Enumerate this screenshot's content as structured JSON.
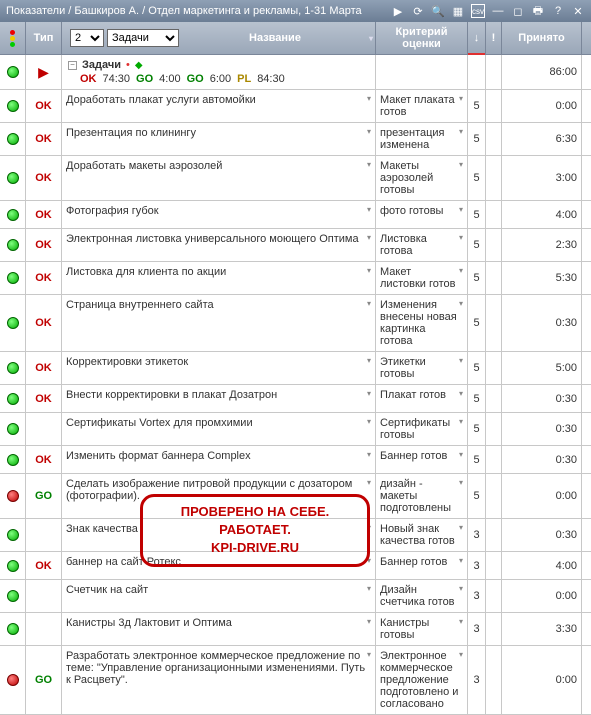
{
  "titlebar": {
    "title": "Показатели / Башкиров А. / Отдел маркетинга и рекламы, 1-31 Марта"
  },
  "header": {
    "type": "Тип",
    "level": "2",
    "category": "Задачи",
    "name": "Название",
    "criteria": "Критерий оценки",
    "arrow": "↓",
    "excl": "!",
    "accepted": "Принято"
  },
  "summary": {
    "label": "Задачи",
    "segments": [
      {
        "tag": "OK",
        "cls": "l-ok",
        "val": "74:30"
      },
      {
        "tag": "GO",
        "cls": "l-go",
        "val": "4:00"
      },
      {
        "tag": "GO",
        "cls": "l-go",
        "val": "6:00"
      },
      {
        "tag": "PL",
        "cls": "l-pl",
        "val": "84:30"
      }
    ],
    "accepted": "86:00"
  },
  "rows": [
    {
      "light": "green",
      "type": "OK",
      "name": "Доработать плакат услуги автомойки",
      "crit": "Макет плаката готов",
      "score": "5",
      "accepted": "0:00"
    },
    {
      "light": "green",
      "type": "OK",
      "name": "Презентация по клинингу",
      "crit": "презентация изменена",
      "score": "5",
      "accepted": "6:30"
    },
    {
      "light": "green",
      "type": "OK",
      "name": "Доработать макеты аэрозолей",
      "crit": "Макеты аэрозолей готовы",
      "score": "5",
      "accepted": "3:00"
    },
    {
      "light": "green",
      "type": "OK",
      "name": "Фотография губок",
      "crit": "фото готовы",
      "score": "5",
      "accepted": "4:00"
    },
    {
      "light": "green",
      "type": "OK",
      "name": "Электронная листовка универсального моющего Оптима",
      "crit": "Листовка готова",
      "score": "5",
      "accepted": "2:30"
    },
    {
      "light": "green",
      "type": "OK",
      "name": "Листовка для клиента по акции",
      "crit": "Макет листовки готов",
      "score": "5",
      "accepted": "5:30"
    },
    {
      "light": "green",
      "type": "OK",
      "name": "Страница внутреннего сайта",
      "crit": "Изменения внесены новая картинка готова",
      "score": "5",
      "accepted": "0:30"
    },
    {
      "light": "green",
      "type": "OK",
      "name": "Корректировки этикеток",
      "crit": "Этикетки готовы",
      "score": "5",
      "accepted": "5:00"
    },
    {
      "light": "green",
      "type": "OK",
      "name": "Внести корректировки в плакат Дозатрон",
      "crit": "Плакат готов",
      "score": "5",
      "accepted": "0:30"
    },
    {
      "light": "green",
      "type": "",
      "name": "Сертификаты Vortex для промхимии",
      "crit": "Сертификаты готовы",
      "score": "5",
      "accepted": "0:30"
    },
    {
      "light": "green",
      "type": "OK",
      "name": "Изменить формат баннера Complex",
      "crit": "Баннер готов",
      "score": "5",
      "accepted": "0:30"
    },
    {
      "light": "red",
      "type": "GO",
      "name": "Сделать изображение питровой продукции с дозатором (фотографии).",
      "crit": "дизайн - макеты подготовлены",
      "score": "5",
      "accepted": "0:00"
    },
    {
      "light": "green",
      "type": "",
      "name": "Знак качества",
      "crit": "Новый знак качества готов",
      "score": "3",
      "accepted": "0:30"
    },
    {
      "light": "green",
      "type": "OK",
      "name": "баннер на сайт Ротекс",
      "crit": "Баннер готов",
      "score": "3",
      "accepted": "4:00"
    },
    {
      "light": "green",
      "type": "",
      "name": "Счетчик на сайт",
      "crit": "Дизайн счетчика готов",
      "score": "3",
      "accepted": "0:00"
    },
    {
      "light": "green",
      "type": "",
      "name": "Канистры 3д Лактовит и Оптима",
      "crit": "Канистры готовы",
      "score": "3",
      "accepted": "3:30"
    },
    {
      "light": "red",
      "type": "GO",
      "name": "Разработать электронное коммерческое предложение по теме: \"Управление организационными изменениями. Путь к Расцвету\".",
      "crit": "Электронное коммерческое предложение подготовлено и согласовано",
      "score": "3",
      "accepted": "0:00"
    }
  ],
  "stamp": {
    "line1": "ПРОВЕРЕНО НА СЕБЕ.",
    "line2": "РАБОТАЕТ.",
    "line3": "KPI-DRIVE.RU"
  }
}
